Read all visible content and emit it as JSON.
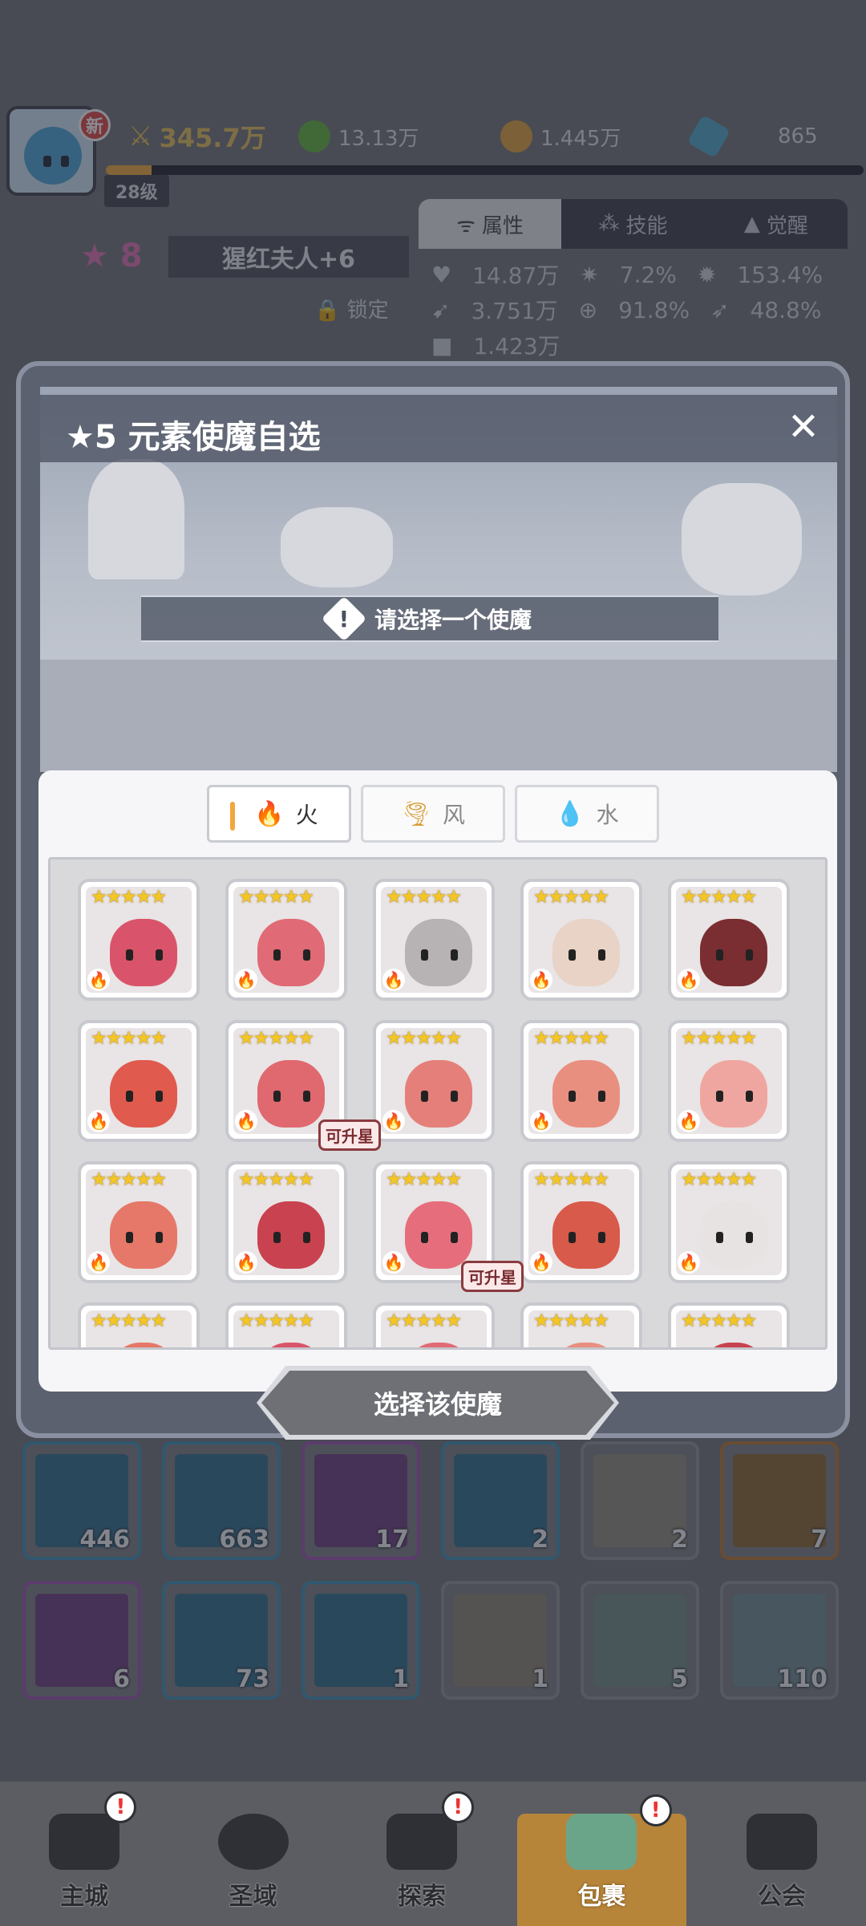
{
  "player": {
    "new_badge": "新",
    "power": "345.7万",
    "level": "28级",
    "level_progress": 0.06,
    "currencies": [
      {
        "icon": "green-orb-icon",
        "value": "13.13万",
        "color": "#5fb33a"
      },
      {
        "icon": "gold-coin-icon",
        "value": "1.445万",
        "color": "#e3a13a"
      },
      {
        "icon": "blue-crystal-icon",
        "value": "865",
        "color": "#4fa6c7"
      }
    ]
  },
  "background": {
    "tabs": [
      "属性",
      "技能",
      "觉醒"
    ],
    "star_level": "8",
    "hero_name": "猩红夫人+6",
    "lock_label": "锁定",
    "stats": [
      [
        "14.87万",
        "7.2%",
        "153.4%"
      ],
      [
        "3.751万",
        "91.8%",
        "48.8%"
      ],
      [
        "1.423万",
        "",
        ""
      ]
    ]
  },
  "modal": {
    "title": "★5 元素使魔自选",
    "close_symbol": "✕",
    "prompt": "请选择一个使魔",
    "prompt_icon": "!",
    "tabs": [
      {
        "label": "火",
        "icon": "fire-icon",
        "active": true
      },
      {
        "label": "风",
        "icon": "wind-icon",
        "active": false
      },
      {
        "label": "水",
        "icon": "water-drop-icon",
        "active": false
      }
    ],
    "stars": "★★★★★",
    "element_symbol": "🔥",
    "upgrade_label": "可升星",
    "select_button": "选择该使魔"
  },
  "inventory": {
    "counts": [
      "446",
      "663",
      "17",
      "2",
      "2",
      "7",
      "6",
      "73",
      "1",
      "1",
      "5",
      "110"
    ]
  },
  "nav": {
    "items": [
      {
        "label": "主城",
        "alert": "!"
      },
      {
        "label": "圣域",
        "alert": ""
      },
      {
        "label": "探索",
        "alert": "!"
      },
      {
        "label": "包裹",
        "alert": "!"
      },
      {
        "label": "公会",
        "alert": ""
      }
    ]
  }
}
